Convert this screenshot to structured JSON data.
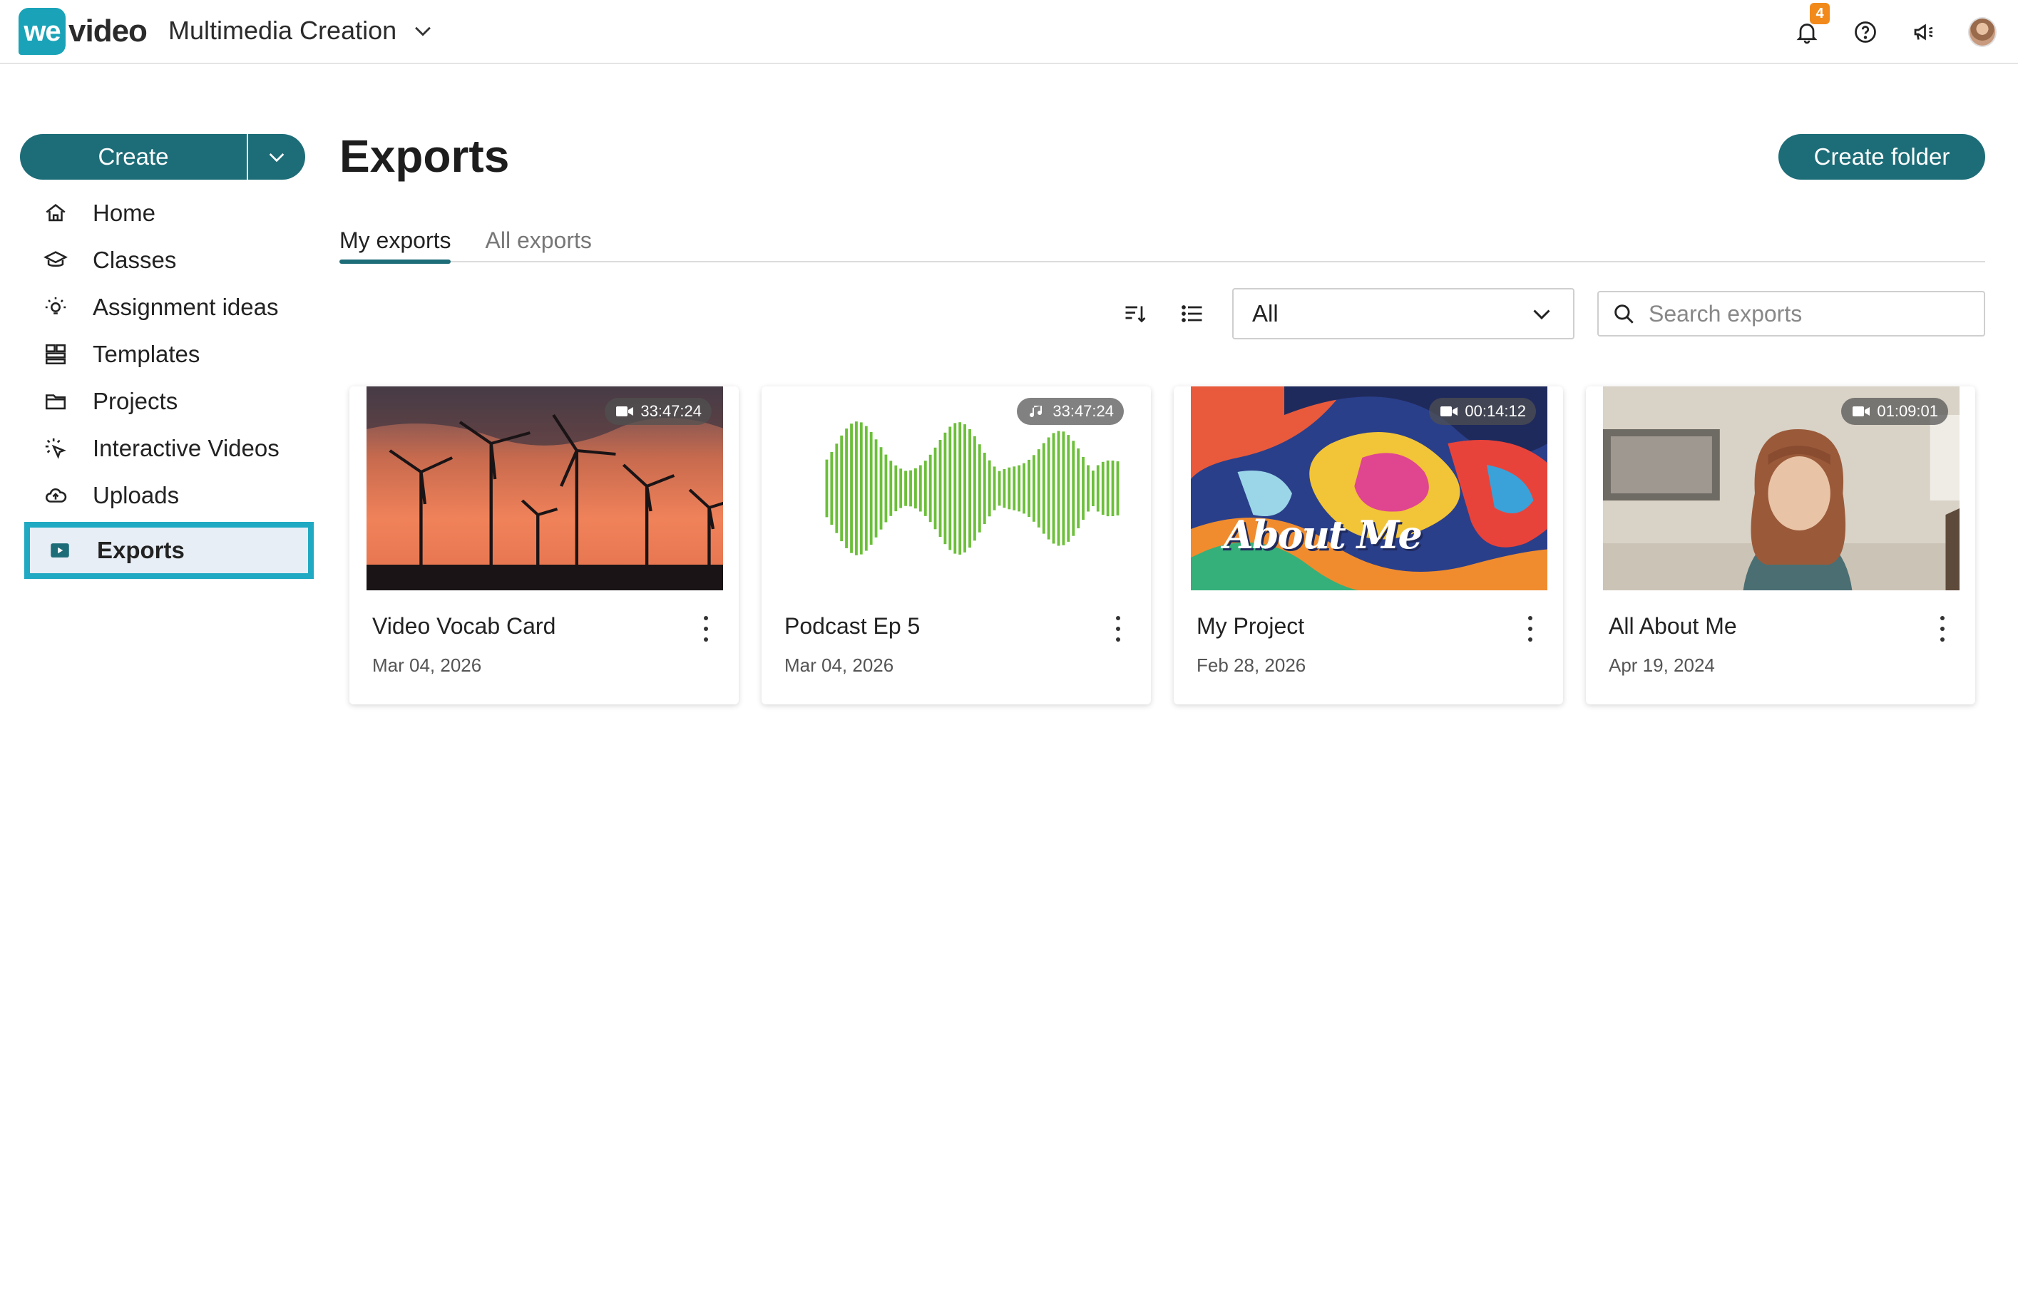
{
  "header": {
    "logo_we": "we",
    "logo_video": "video",
    "workspace": "Multimedia Creation",
    "notifications_count": "4"
  },
  "sidebar": {
    "create_label": "Create",
    "items": [
      {
        "label": "Home",
        "icon": "home-icon"
      },
      {
        "label": "Classes",
        "icon": "classes-icon"
      },
      {
        "label": "Assignment ideas",
        "icon": "lightbulb-icon"
      },
      {
        "label": "Templates",
        "icon": "templates-icon"
      },
      {
        "label": "Projects",
        "icon": "folder-icon"
      },
      {
        "label": "Interactive Videos",
        "icon": "interactive-cursor-icon"
      },
      {
        "label": "Uploads",
        "icon": "cloud-upload-icon"
      },
      {
        "label": "Exports",
        "icon": "export-play-icon",
        "active": true
      }
    ]
  },
  "main": {
    "title": "Exports",
    "create_folder_label": "Create folder",
    "tabs": [
      {
        "label": "My exports",
        "active": true
      },
      {
        "label": "All exports"
      }
    ],
    "filter": {
      "selected": "All"
    },
    "search": {
      "placeholder": "Search exports"
    },
    "cards": [
      {
        "title": "Video Vocab Card",
        "date": "Mar 04, 2026",
        "duration": "33:47:24",
        "media": "video"
      },
      {
        "title": "Podcast Ep 5",
        "date": "Mar 04, 2026",
        "duration": "33:47:24",
        "media": "audio"
      },
      {
        "title": "My Project",
        "date": "Feb 28, 2026",
        "duration": "00:14:12",
        "media": "video",
        "thumb_text": "About Me"
      },
      {
        "title": "All About Me",
        "date": "Apr 19, 2024",
        "duration": "01:09:01",
        "media": "video"
      }
    ]
  },
  "colors": {
    "brand_teal": "#1d6d78",
    "logo_teal": "#1aa3b8",
    "highlight": "#20a9c2",
    "badge_orange": "#f28a1b",
    "waveform_green": "#6cbf3a"
  }
}
